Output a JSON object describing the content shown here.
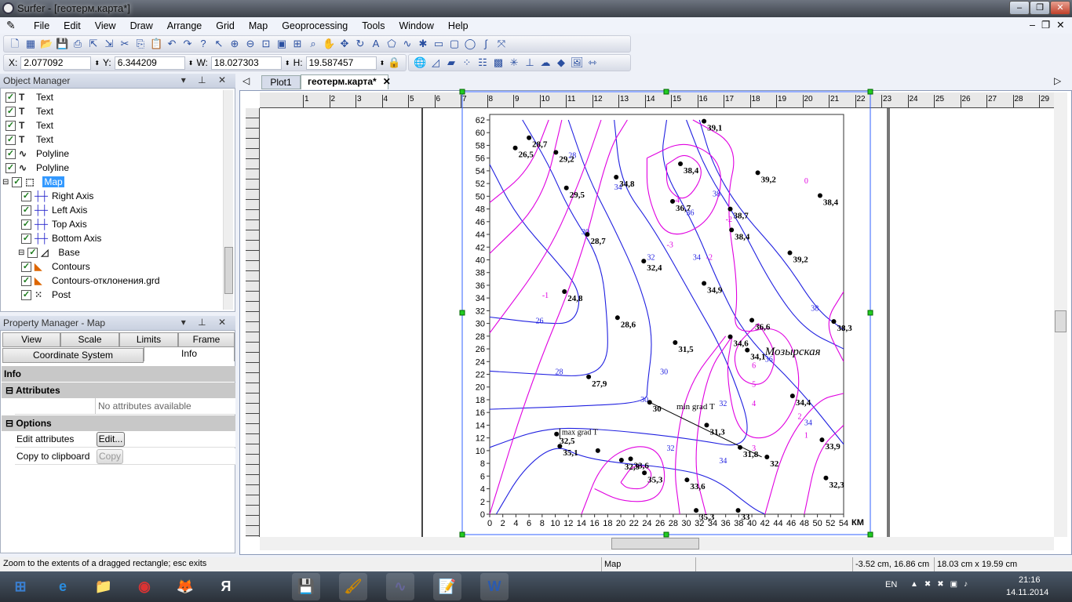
{
  "window": {
    "title": "Surfer - [геотерм.карта*]",
    "min": "–",
    "max": "❐",
    "close": "✕"
  },
  "menu": [
    "File",
    "Edit",
    "View",
    "Draw",
    "Arrange",
    "Grid",
    "Map",
    "Geoprocessing",
    "Tools",
    "Window",
    "Help"
  ],
  "toolbar1": [
    "new-plot",
    "new-worksheet",
    "open",
    "save",
    "print",
    "export",
    "import",
    "cut",
    "copy",
    "paste",
    "undo",
    "redo",
    "help",
    "select",
    "zoom-in",
    "zoom-out",
    "zoom-rect",
    "zoom-page",
    "zoom-fit",
    "zoom-actual",
    "pan",
    "redraw",
    "rotate",
    "text",
    "polygon",
    "polyline",
    "symbol",
    "rectangle",
    "rounded-rectangle",
    "ellipse",
    "spline",
    "reshape"
  ],
  "coords": {
    "x_label": "X:",
    "x": "2.077092",
    "y_label": "Y:",
    "y": "6.344209",
    "w_label": "W:",
    "w": "18.027303",
    "h_label": "H:",
    "h": "19.587457"
  },
  "toolbar2": [
    "base-map",
    "contour-map",
    "color-relief",
    "post-map",
    "classed-post",
    "image",
    "vector",
    "axes",
    "3d-surface",
    "3d-wireframe",
    "add-image",
    "measure"
  ],
  "object_manager": {
    "title": "Object Manager",
    "items": [
      {
        "label": "Text",
        "icon": "text-icon",
        "level": 0
      },
      {
        "label": "Text",
        "icon": "text-icon",
        "level": 0
      },
      {
        "label": "Text",
        "icon": "text-icon",
        "level": 0
      },
      {
        "label": "Text",
        "icon": "text-icon",
        "level": 0
      },
      {
        "label": "Polyline",
        "icon": "polyline-icon",
        "level": 0
      },
      {
        "label": "Polyline",
        "icon": "polyline-icon",
        "level": 0
      },
      {
        "label": "Map",
        "icon": "map-icon",
        "level": 0,
        "selected": true
      },
      {
        "label": "Right Axis",
        "icon": "axis-icon",
        "level": 1
      },
      {
        "label": "Left Axis",
        "icon": "axis-icon",
        "level": 1
      },
      {
        "label": "Top Axis",
        "icon": "axis-icon",
        "level": 1
      },
      {
        "label": "Bottom Axis",
        "icon": "axis-icon",
        "level": 1
      },
      {
        "label": "Base",
        "icon": "base-map-icon",
        "level": 1
      },
      {
        "label": "Contours",
        "icon": "contour-icon",
        "level": 1
      },
      {
        "label": "Contours-отклонения.grd",
        "icon": "contour-icon",
        "level": 1
      },
      {
        "label": "Post",
        "icon": "post-icon",
        "level": 1
      }
    ]
  },
  "property_manager": {
    "title": "Property Manager - Map",
    "tabs": [
      "View",
      "Scale",
      "Limits",
      "Frame",
      "Coordinate System",
      "Info"
    ],
    "active_tab": "Info",
    "info": "Info",
    "attributes": "Attributes",
    "no_attributes": "No attributes available",
    "options": "Options",
    "edit_label": "Edit attributes",
    "edit_button": "Edit...",
    "copy_label": "Copy to clipboard",
    "copy_button": "Copy"
  },
  "doc_tabs": [
    "Plot1",
    "геотерм.карта*"
  ],
  "active_doc": "геотерм.карта*",
  "ruler_top": [
    "1",
    "2",
    "3",
    "4",
    "5",
    "6",
    "7",
    "8",
    "9",
    "10",
    "11",
    "12",
    "13",
    "14",
    "15",
    "16",
    "17",
    "18",
    "19",
    "20",
    "21",
    "22",
    "23",
    "24",
    "25",
    "26",
    "27",
    "28",
    "29"
  ],
  "map": {
    "x_ticks": [
      0,
      2,
      4,
      6,
      8,
      10,
      12,
      14,
      16,
      18,
      20,
      22,
      24,
      26,
      28,
      30,
      32,
      34,
      36,
      38,
      40,
      42,
      44,
      46,
      48,
      50,
      52,
      54
    ],
    "y_ticks": [
      0,
      2,
      4,
      6,
      8,
      10,
      12,
      14,
      16,
      18,
      20,
      22,
      24,
      26,
      28,
      30,
      32,
      34,
      36,
      38,
      40,
      42,
      44,
      46,
      48,
      50,
      52,
      54,
      56,
      58,
      60,
      62
    ],
    "x_unit": "КМ",
    "colors": {
      "temperature_contours": "#2020e0",
      "deviation_contours": "#e000e0",
      "points": "#000000"
    },
    "points": [
      [
        3.9,
        57.6,
        "26,5"
      ],
      [
        6.0,
        59.2,
        "28,7"
      ],
      [
        10.1,
        56.9,
        "29,2"
      ],
      [
        11.7,
        51.3,
        "29,5"
      ],
      [
        14.9,
        44.0,
        "28,7"
      ],
      [
        11.4,
        35.0,
        "24,8"
      ],
      [
        15.1,
        21.6,
        "27,9"
      ],
      [
        19.5,
        30.9,
        "28,6"
      ],
      [
        19.3,
        53.0,
        "34,8"
      ],
      [
        29.1,
        55.1,
        "38,4"
      ],
      [
        27.9,
        49.2,
        "36,7"
      ],
      [
        32.7,
        61.8,
        "39,1"
      ],
      [
        40.9,
        53.7,
        "39,2"
      ],
      [
        50.4,
        50.1,
        "38,4"
      ],
      [
        36.7,
        48.0,
        "38,7"
      ],
      [
        36.9,
        44.7,
        "38,4"
      ],
      [
        45.8,
        41.1,
        "39,2"
      ],
      [
        23.5,
        39.8,
        "32,4"
      ],
      [
        32.7,
        36.3,
        "34,9"
      ],
      [
        40.0,
        30.5,
        "36,6"
      ],
      [
        52.5,
        30.3,
        "38,3"
      ],
      [
        36.7,
        27.9,
        "34,6"
      ],
      [
        28.3,
        27.0,
        "31,5"
      ],
      [
        39.3,
        25.8,
        "34,1"
      ],
      [
        24.4,
        17.6,
        "30"
      ],
      [
        46.2,
        18.6,
        "34,4"
      ],
      [
        33.1,
        14.0,
        "31,3"
      ],
      [
        10.2,
        12.6,
        "32,5"
      ],
      [
        10.7,
        10.7,
        "35,1"
      ],
      [
        16.5,
        10.0,
        ""
      ],
      [
        20.1,
        8.5,
        "32,9"
      ],
      [
        21.5,
        8.7,
        "33,6"
      ],
      [
        23.6,
        6.5,
        "35,3"
      ],
      [
        30.1,
        5.4,
        "33,6"
      ],
      [
        31.5,
        0.6,
        "35,3"
      ],
      [
        37.9,
        0.6,
        "33"
      ],
      [
        38.2,
        10.5,
        "31,8"
      ],
      [
        42.3,
        9.0,
        "32"
      ],
      [
        50.7,
        11.7,
        "33,9"
      ],
      [
        51.3,
        5.7,
        "32,3"
      ]
    ],
    "contour_labels_blue": [
      "26",
      "28",
      "28",
      "30",
      "30",
      "30",
      "32",
      "32",
      "32",
      "34",
      "34",
      "34",
      "34",
      "36",
      "36",
      "38",
      "38"
    ],
    "contour_labels_magenta": [
      "-1",
      "-2",
      "-2",
      "-3",
      "-4",
      "0",
      "1",
      "2",
      "3",
      "4",
      "5",
      "6"
    ],
    "annotations": {
      "region": "Мозырская",
      "min_grad": "min grad T",
      "max_grad": "max grad T"
    }
  },
  "status": {
    "hint": "Zoom to the extents of a dragged rectangle; esc exits",
    "selection": "Map",
    "cursor": "-3.52 cm, 16.86 cm",
    "size": "18.03 cm x 19.59 cm"
  },
  "taskbar": {
    "apps": [
      "start",
      "internet-explorer",
      "explorer",
      "chrome",
      "firefox",
      "yandex",
      "save-app",
      "paint-app",
      "surfer",
      "notepad",
      "word"
    ],
    "lang": "EN",
    "time": "21:16",
    "date": "14.11.2014"
  }
}
